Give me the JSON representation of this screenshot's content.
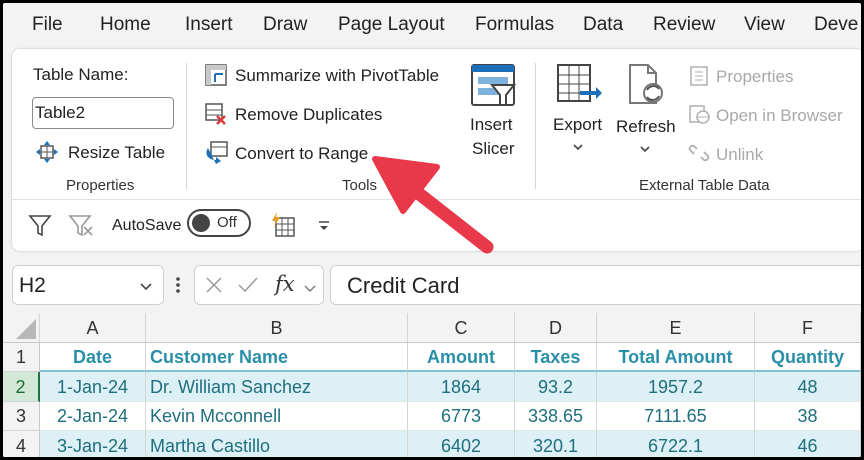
{
  "menu": {
    "tabs": [
      "File",
      "Home",
      "Insert",
      "Draw",
      "Page Layout",
      "Formulas",
      "Data",
      "Review",
      "View",
      "Deve"
    ]
  },
  "ribbon": {
    "properties": {
      "table_name_label": "Table Name:",
      "table_name_value": "Table2",
      "resize_label": "Resize Table",
      "group_label": "Properties"
    },
    "tools": {
      "summarize_label": "Summarize with PivotTable",
      "remove_dup_label": "Remove Duplicates",
      "convert_label": "Convert to Range",
      "group_label": "Tools"
    },
    "slicer": {
      "line1": "Insert",
      "line2": "Slicer"
    },
    "external": {
      "export_label": "Export",
      "refresh_label": "Refresh",
      "properties_label": "Properties",
      "open_browser_label": "Open in Browser",
      "unlink_label": "Unlink",
      "group_label": "External Table Data"
    },
    "qat": {
      "autosave_label": "AutoSave",
      "toggle_state": "Off"
    }
  },
  "formula_bar": {
    "name_box": "H2",
    "fx_label": "fx",
    "formula": "Credit Card"
  },
  "sheet": {
    "columns": [
      "A",
      "B",
      "C",
      "D",
      "E",
      "F"
    ],
    "rows": [
      {
        "num": "1",
        "cells": [
          "Date",
          "Customer Name",
          "Amount",
          "Taxes",
          "Total Amount",
          "Quantity"
        ]
      },
      {
        "num": "2",
        "cells": [
          "1-Jan-24",
          "Dr. William Sanchez",
          "1864",
          "93.2",
          "1957.2",
          "48"
        ]
      },
      {
        "num": "3",
        "cells": [
          "2-Jan-24",
          "Kevin Mcconnell",
          "6773",
          "338.65",
          "7111.65",
          "38"
        ]
      },
      {
        "num": "4",
        "cells": [
          "3-Jan-24",
          "Martha Castillo",
          "6402",
          "320.1",
          "6722.1",
          "46"
        ]
      }
    ]
  },
  "colors": {
    "table_header": "#2a8fa8",
    "table_text": "#1f6f7e",
    "band": "#dcf0f5",
    "arrow": "#e8384a",
    "selected_row": "#217346"
  }
}
